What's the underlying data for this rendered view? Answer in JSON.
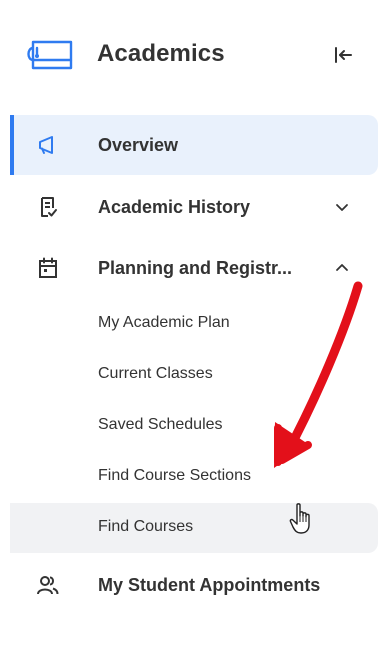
{
  "header": {
    "title": "Academics",
    "app_icon": "graduation-cap-icon",
    "collapse_icon": "collapse-left-icon"
  },
  "nav": {
    "items": [
      {
        "label": "Overview",
        "icon": "megaphone-icon",
        "active": true
      },
      {
        "label": "Academic History",
        "icon": "document-check-icon",
        "expanded": false
      },
      {
        "label": "Planning and Registr...",
        "icon": "calendar-icon",
        "expanded": true
      },
      {
        "label": "My Student Appointments",
        "icon": "people-icon"
      }
    ],
    "subitems": [
      {
        "label": "My Academic Plan"
      },
      {
        "label": "Current Classes"
      },
      {
        "label": "Saved Schedules"
      },
      {
        "label": "Find Course Sections"
      },
      {
        "label": "Find Courses",
        "hovered": true
      }
    ]
  },
  "colors": {
    "accent": "#2f7bf0",
    "active_bg": "#e9f1fc",
    "hover_bg": "#f1f2f4",
    "text": "#333333",
    "annotation_arrow": "#e3101a"
  },
  "annotation": {
    "arrow_icon": "red-arrow-icon",
    "cursor_icon": "hand-pointer-icon"
  }
}
